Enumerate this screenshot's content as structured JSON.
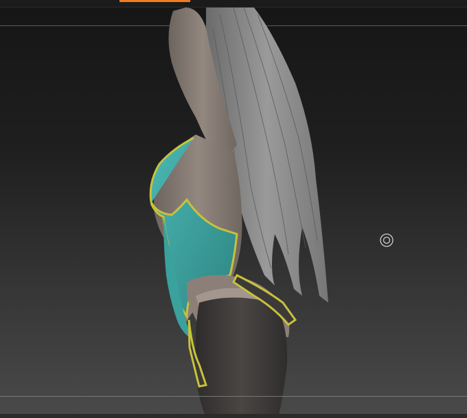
{
  "app": {
    "active_tab_color": "#f07c1f",
    "viewport_background": "#1f1f1f"
  },
  "viewport": {
    "model": {
      "skin_color": "#8c8178",
      "hair_color": "#8a8a8a",
      "garment_color": "#3fa7a3",
      "trim_color": "#c8c23b",
      "stocking_color": "#3f3c3b"
    },
    "pivot_icon": "target-circle-icon"
  }
}
